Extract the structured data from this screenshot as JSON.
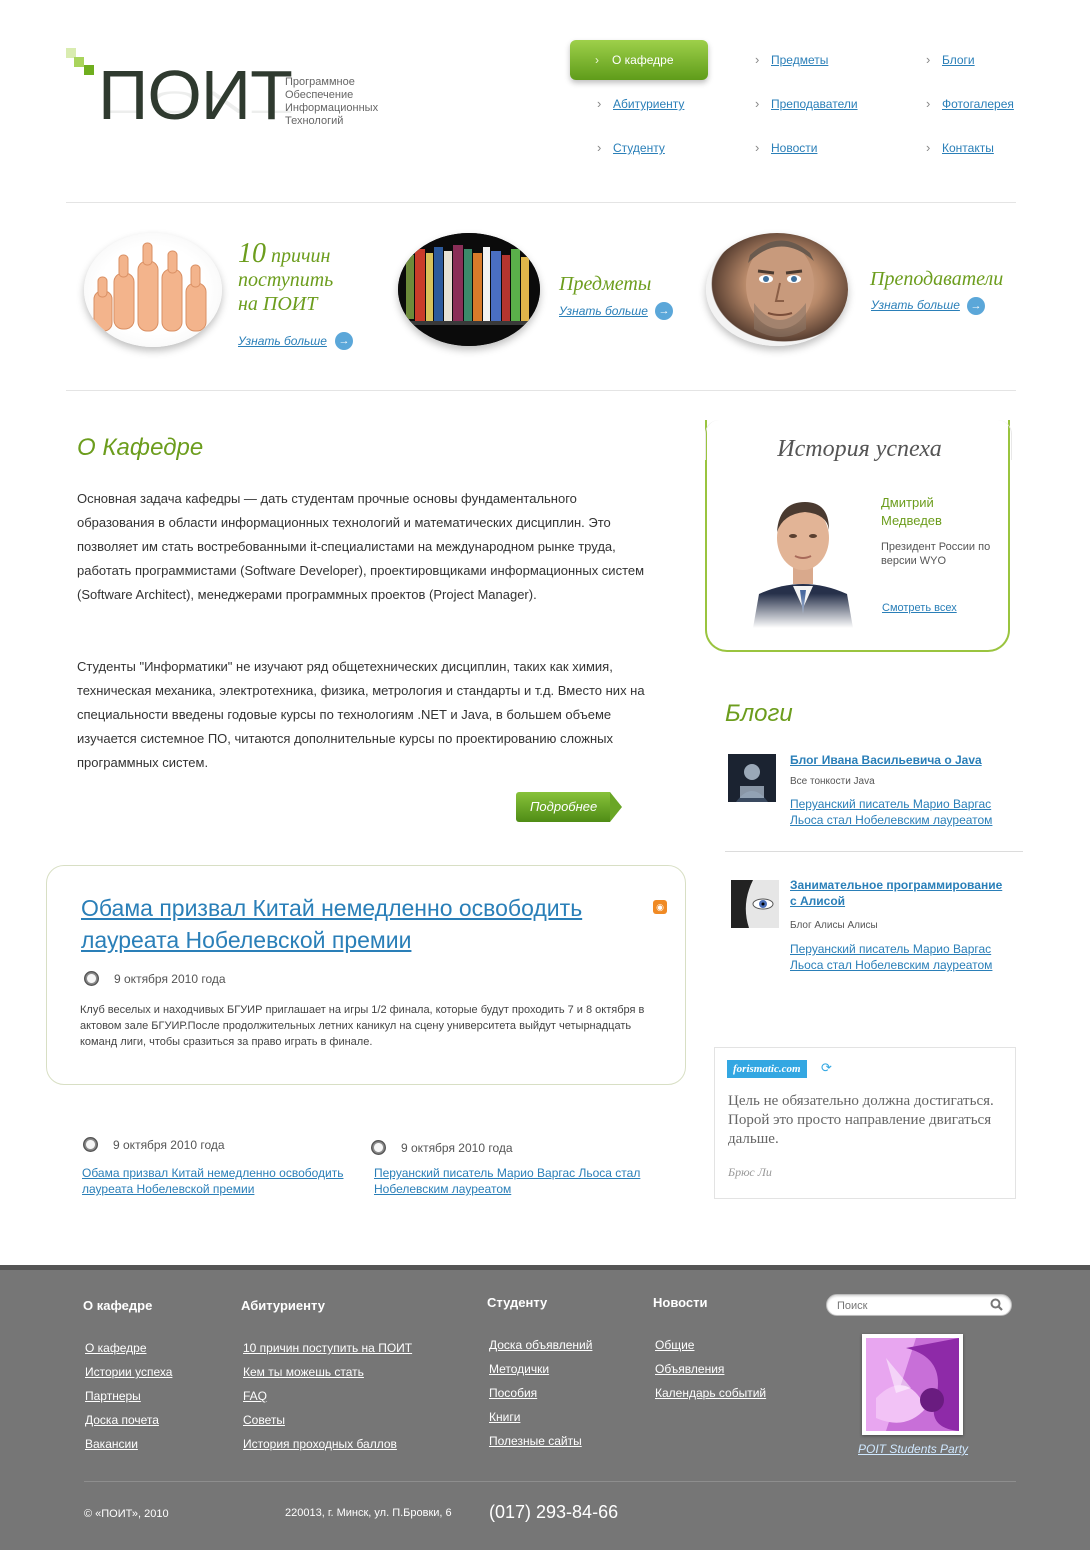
{
  "header": {
    "logo_text": "ПОИТ",
    "logo_subtitle": [
      "Программное",
      "Обеспечение",
      "Информационных",
      "Технологий"
    ],
    "nav": {
      "active": "О кафедре",
      "items": [
        "Предметы",
        "Блоги",
        "Абитуриенту",
        "Преподаватели",
        "Фотогалерея",
        "Студенту",
        "Новости",
        "Контакты"
      ]
    }
  },
  "promo": [
    {
      "number": "10",
      "title_rest": "причин",
      "title_line2": "поступить",
      "title_line3": "на ПОИТ",
      "more": "Узнать больше"
    },
    {
      "title": "Предметы",
      "more": "Узнать больше"
    },
    {
      "title": "Преподаватели",
      "more": "Узнать больше"
    }
  ],
  "about": {
    "heading": "О Кафедре",
    "para1": "Основная задача кафедры — дать студентам прочные основы фундаментального образования в области информационных технологий и математических дисциплин. Это позволяет им стать востребованными it-специалистами на международном рынке труда, работать программистами (Software Developer), проектировщиками информационных систем (Software Architect), менеджерами программных проектов (Project Manager).",
    "para2": "Студенты \"Информатики\" не изучают ряд общетехнических дисциплин, таких как химия, техническая механика, электротехника, физика, метрология и стандарты и т.д. Вместо них на специальности введены годовые курсы по технологиям .NET и Java, в большем объеме изучается системное ПО, читаются дополнительные курсы по проектированию сложных программных систем.",
    "more_button": "Подробнее"
  },
  "news_main": {
    "title": "Обама призвал Китай немедленно освободить лауреата Нобелевской премии",
    "date": "9 октября 2010 года",
    "text": "Клуб веселых и находчивых БГУИР приглашает на игры 1/2 финала, которые будут проходить 7 и 8 октября в актовом зале БГУИР.После продолжительных летних каникул на сцену университета выйдут четырнадцать команд лиги, чтобы сразиться за право играть в финале."
  },
  "news_small": [
    {
      "date": "9 октября 2010 года",
      "title": "Обама призвал Китай немедленно освободить лауреата Нобелевской премии"
    },
    {
      "date": "9 октября 2010 года",
      "title": "Перуанский писатель Марио Варгас Льоса стал Нобелевским лауреатом"
    }
  ],
  "success": {
    "heading": "История успеха",
    "name": "Дмитрий Медведев",
    "desc": "Президент России по версии WYO",
    "link": "Смотреть всех"
  },
  "blogs": {
    "heading": "Блоги",
    "items": [
      {
        "title": "Блог Ивана Васильевича о Java",
        "author": "Все тонкости Java",
        "post": "Перуанский писатель Марио Варгас Льоса стал Нобелевским лауреатом"
      },
      {
        "title": "Занимательное программирование с Алисой",
        "author": "Блог Алисы Алисы",
        "post": "Перуанский писатель Марио Варгас Льоса стал Нобелевским лауреатом"
      }
    ]
  },
  "quote": {
    "badge": "forismatic.com",
    "text": "Цель не обязательно должна достигаться. Порой это просто направление двигаться дальше.",
    "author": "Брюс Ли"
  },
  "footer": {
    "columns": [
      {
        "heading": "О кафедре",
        "links": [
          "О кафедре",
          "Истории успеха",
          "Партнеры",
          "Доска почета",
          "Вакансии"
        ]
      },
      {
        "heading": "Абитуриенту",
        "links": [
          "10 причин поступить на ПОИТ",
          "Кем ты можешь стать",
          "FAQ",
          "Советы",
          "История проходных баллов"
        ]
      },
      {
        "heading": "Студенту",
        "links": [
          "Доска объявлений",
          "Методички",
          "Пособия",
          "Книги",
          "Полезные сайты"
        ]
      },
      {
        "heading": "Новости",
        "links": [
          "Общие",
          "Объявления",
          "Календарь событий"
        ]
      }
    ],
    "search_placeholder": "Поиск",
    "photo_caption": "POIT Students Party",
    "copyright": "© «ПОИТ», 2010",
    "address": "220013, г. Минск, ул. П.Бровки, 6",
    "phone": "(017) 293-84-66"
  },
  "colors": {
    "accent_green": "#6c9d1d",
    "link_blue": "#2a7fb8",
    "footer_bg": "#767676"
  }
}
